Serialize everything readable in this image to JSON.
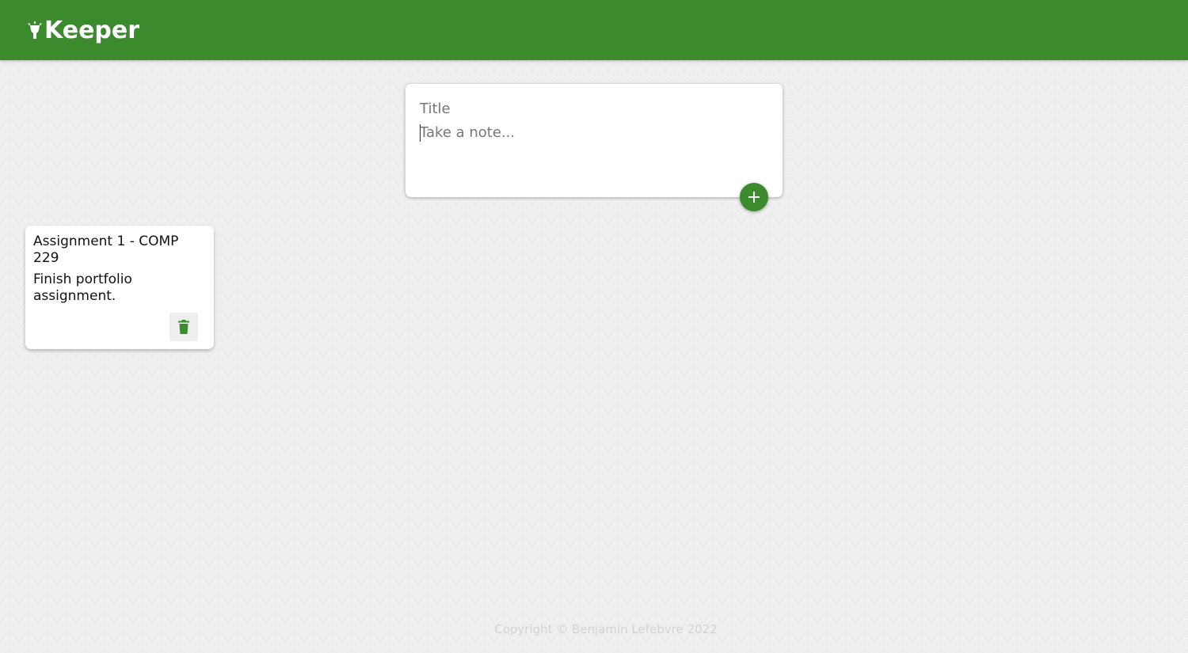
{
  "app": {
    "name": "Keeper",
    "logo_icon": "lightbulb-icon"
  },
  "create_note": {
    "title_placeholder": "Title",
    "content_placeholder": "Take a note...",
    "add_icon": "plus-icon"
  },
  "notes": [
    {
      "title": "Assignment 1 - COMP 229",
      "content": "Finish portfolio assignment.",
      "delete_icon": "trash-icon"
    }
  ],
  "footer": {
    "text": "Copyright © Benjamin Lefebvre 2022"
  },
  "colors": {
    "brand": "#3c8a2e",
    "background": "#eeeeee",
    "card": "#ffffff"
  }
}
